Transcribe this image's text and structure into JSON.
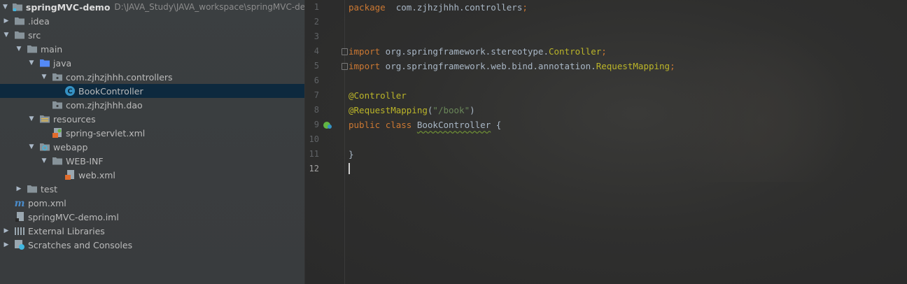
{
  "project_tree": [
    {
      "label": "springMVC-demo",
      "path": "D:\\JAVA_Study\\JAVA_workspace\\springMVC-demo",
      "arrow": "down",
      "icon": "module-folder-icon"
    },
    {
      "label": ".idea",
      "arrow": "right",
      "icon": "folder-icon"
    },
    {
      "label": "src",
      "arrow": "down",
      "icon": "folder-icon"
    },
    {
      "label": "main",
      "arrow": "down",
      "icon": "folder-icon"
    },
    {
      "label": "java",
      "arrow": "down",
      "icon": "source-folder-icon"
    },
    {
      "label": "com.zjhzjhhh.controllers",
      "arrow": "down",
      "icon": "package-icon"
    },
    {
      "label": "BookController",
      "arrow": "none",
      "icon": "java-class-icon",
      "selected": true
    },
    {
      "label": "com.zjhzjhhh.dao",
      "arrow": "none",
      "icon": "package-icon"
    },
    {
      "label": "resources",
      "arrow": "down",
      "icon": "resources-folder-icon"
    },
    {
      "label": "spring-servlet.xml",
      "arrow": "none",
      "icon": "spring-xml-icon"
    },
    {
      "label": "webapp",
      "arrow": "down",
      "icon": "web-folder-icon"
    },
    {
      "label": "WEB-INF",
      "arrow": "down",
      "icon": "folder-icon"
    },
    {
      "label": "web.xml",
      "arrow": "none",
      "icon": "xml-file-icon"
    },
    {
      "label": "test",
      "arrow": "right",
      "icon": "folder-icon"
    },
    {
      "label": "pom.xml",
      "arrow": "none",
      "icon": "maven-icon"
    },
    {
      "label": "springMVC-demo.iml",
      "arrow": "none",
      "icon": "iml-file-icon"
    },
    {
      "label": "External Libraries",
      "arrow": "right",
      "icon": "libraries-icon"
    },
    {
      "label": "Scratches and Consoles",
      "arrow": "right",
      "icon": "scratches-icon"
    }
  ],
  "editor": {
    "current_line": 12,
    "lines": [
      {
        "n": "1",
        "tokens": [
          [
            "kw",
            "package"
          ],
          [
            "",
            "  com.zjhzjhhh.controllers"
          ],
          [
            "kw",
            ";"
          ]
        ]
      },
      {
        "n": "2",
        "tokens": []
      },
      {
        "n": "3",
        "tokens": []
      },
      {
        "n": "4",
        "fold": true,
        "tokens": [
          [
            "kw",
            "import"
          ],
          [
            "",
            " org.springframework.stereotype."
          ],
          [
            "ann",
            "Controller"
          ],
          [
            "kw",
            ";"
          ]
        ]
      },
      {
        "n": "5",
        "fold": true,
        "tokens": [
          [
            "kw",
            "import"
          ],
          [
            "",
            " org.springframework.web.bind.annotation."
          ],
          [
            "ann",
            "RequestMapping"
          ],
          [
            "kw",
            ";"
          ]
        ]
      },
      {
        "n": "6",
        "tokens": []
      },
      {
        "n": "7",
        "tokens": [
          [
            "ann",
            "@Controller"
          ]
        ]
      },
      {
        "n": "8",
        "tokens": [
          [
            "ann",
            "@RequestMapping"
          ],
          [
            "",
            "("
          ],
          [
            "str",
            "\"/book\""
          ],
          [
            "",
            ")"
          ]
        ]
      },
      {
        "n": "9",
        "gutter_icon": "spring-bean-icon",
        "tokens": [
          [
            "kw",
            "public"
          ],
          [
            "",
            " "
          ],
          [
            "kw",
            "class"
          ],
          [
            "",
            " "
          ],
          [
            "cls",
            "BookController"
          ],
          [
            "",
            " {"
          ]
        ]
      },
      {
        "n": "10",
        "tokens": []
      },
      {
        "n": "11",
        "tokens": [
          [
            "",
            "}"
          ]
        ]
      },
      {
        "n": "12",
        "tokens": []
      }
    ]
  },
  "colors": {
    "keyword": "#cc7832",
    "annotation": "#bbb529",
    "string": "#6a8759",
    "text": "#a9b7c6",
    "selection": "#0d293e"
  }
}
